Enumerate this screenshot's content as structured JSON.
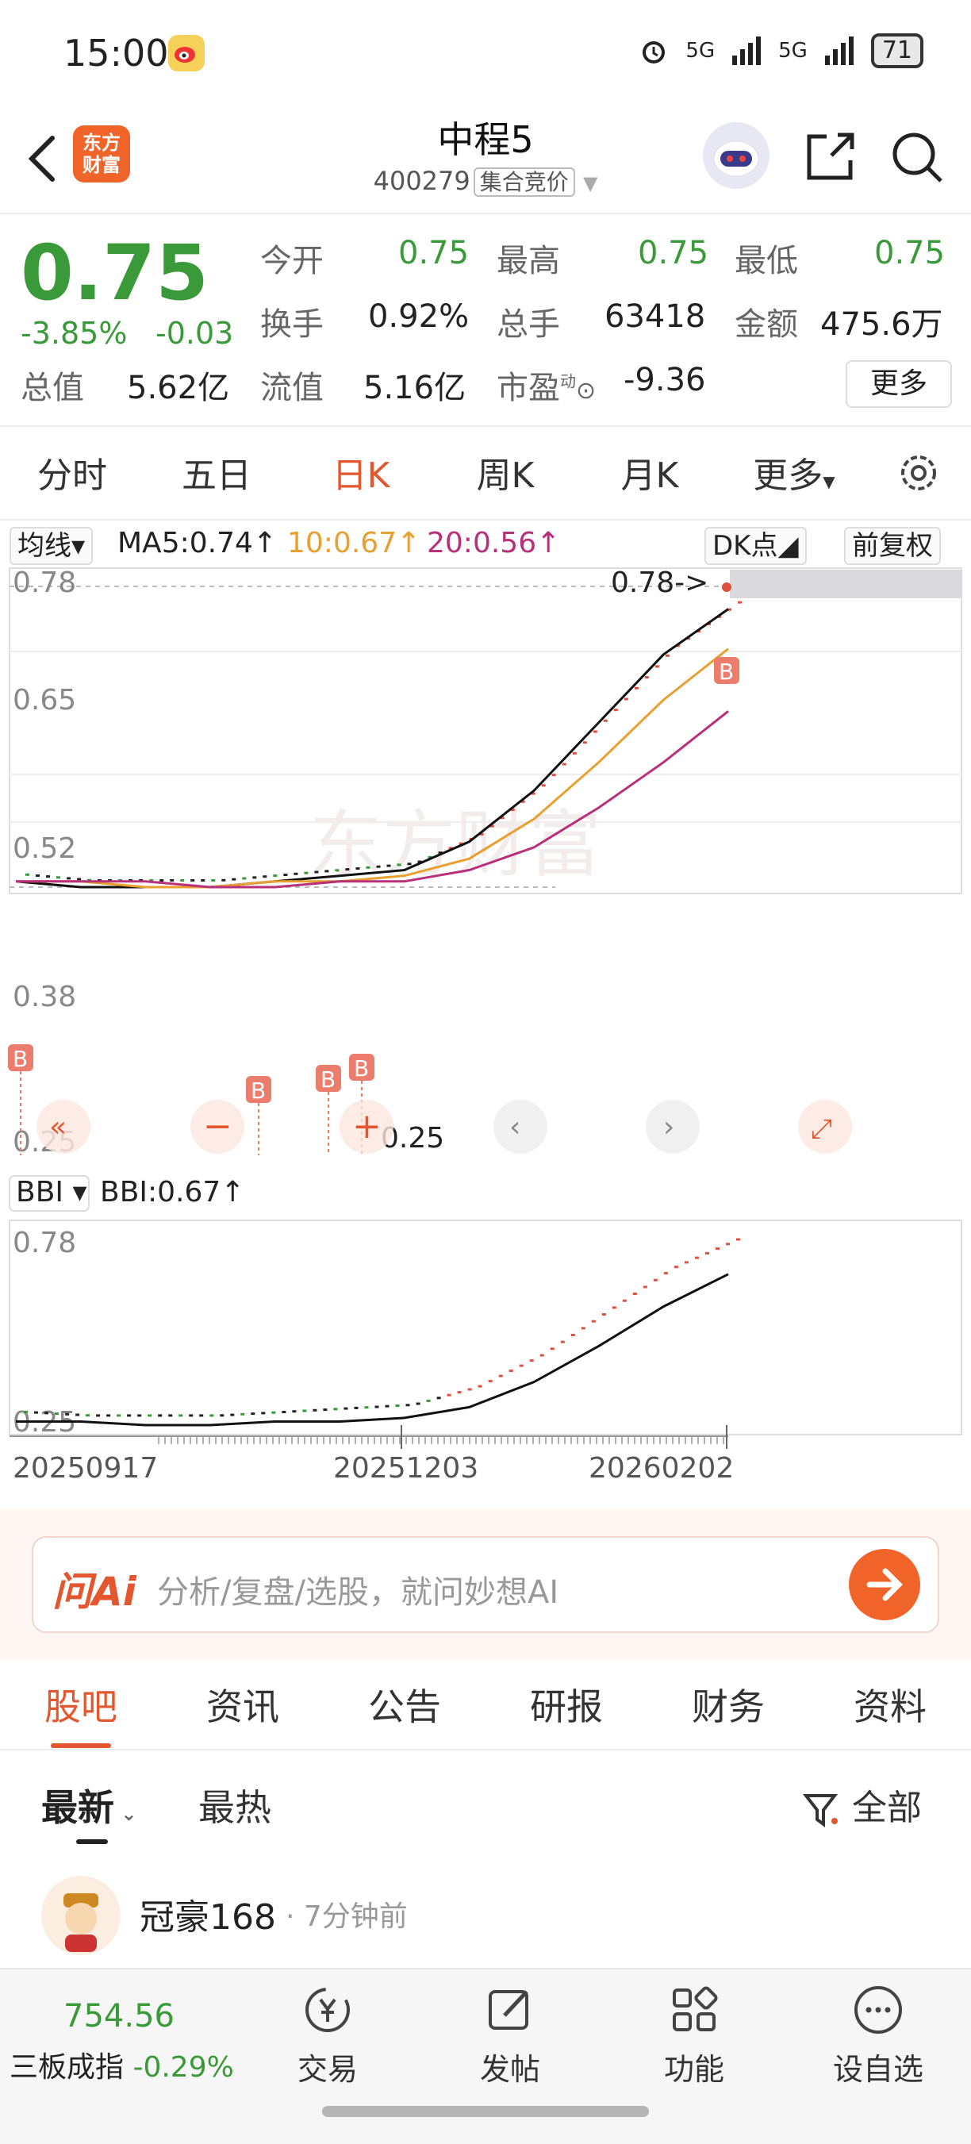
{
  "status": {
    "time": "15:00",
    "net1": "5G",
    "net2": "5G",
    "battery": "71"
  },
  "header": {
    "logo_line1": "东方",
    "logo_line2": "财富",
    "title": "中程5",
    "code": "400279",
    "tag": "集合竞价"
  },
  "quote": {
    "price": "0.75",
    "change_pct": "-3.85%",
    "change_abs": "-0.03",
    "open_label": "今开",
    "open_value": "0.75",
    "high_label": "最高",
    "high_value": "0.75",
    "low_label": "最低",
    "low_value": "0.75",
    "turnover_label": "换手",
    "turnover_value": "0.92%",
    "volume_label": "总手",
    "volume_value": "63418",
    "amount_label": "金额",
    "amount_value": "475.6万",
    "mktcap_label": "总值",
    "mktcap_value": "5.62亿",
    "float_label": "流值",
    "float_value": "5.16亿",
    "pe_label": "市盈",
    "pe_sup": "动",
    "pe_value": "-9.36",
    "more_label": "更多"
  },
  "ktabs": [
    "分时",
    "五日",
    "日K",
    "周K",
    "月K",
    "更多"
  ],
  "ktab_active": 2,
  "chart": {
    "ma_selector": "均线",
    "ma5": "MA5:0.74↑",
    "ma10": "10:0.67↑",
    "ma20": "20:0.56↑",
    "dk_label": "DK点",
    "adjust_label": "前复权",
    "price_ticks": [
      "0.78",
      "0.65",
      "0.52",
      "0.38",
      "0.25"
    ],
    "high_marker": "0.78->",
    "low_marker": "0.25",
    "watermark": "东方财富",
    "buy_marker": "B",
    "bbi_selector": "BBI",
    "bbi_value": "BBI:0.67↑",
    "bbi_ticks": [
      "0.78",
      "0.25"
    ],
    "dates": [
      "20250917",
      "20251203",
      "20260202"
    ],
    "colors": {
      "ma5": "#111111",
      "ma10": "#e8a030",
      "ma20": "#b8307a",
      "up": "#e05040",
      "down": "#3a9a3a"
    }
  },
  "chart_data": {
    "type": "line",
    "x": [
      "20250917",
      "20251203",
      "20260202"
    ],
    "series": [
      {
        "name": "MA5",
        "values": [
          0.26,
          0.25,
          0.25,
          0.25,
          0.26,
          0.27,
          0.28,
          0.33,
          0.42,
          0.54,
          0.66,
          0.74
        ]
      },
      {
        "name": "10",
        "values": [
          0.26,
          0.26,
          0.25,
          0.25,
          0.26,
          0.26,
          0.27,
          0.3,
          0.37,
          0.47,
          0.58,
          0.67
        ]
      },
      {
        "name": "20",
        "values": [
          0.26,
          0.26,
          0.26,
          0.25,
          0.25,
          0.26,
          0.26,
          0.28,
          0.32,
          0.39,
          0.47,
          0.56
        ]
      }
    ],
    "ylim": [
      0.25,
      0.78
    ]
  },
  "ai": {
    "brand": "问Ai",
    "placeholder": "分析/复盘/选股，就问妙想AI"
  },
  "subtabs": [
    "股吧",
    "资讯",
    "公告",
    "研报",
    "财务",
    "资料"
  ],
  "sort": {
    "latest": "最新",
    "hottest": "最热",
    "filter": "全部"
  },
  "feed": [
    {
      "user": "冠豪168",
      "time": "7分钟前"
    }
  ],
  "bottom": {
    "index_value": "754.56",
    "index_name": "三板成指",
    "index_change": "-0.29%",
    "trade": "交易",
    "post": "发帖",
    "functions": "功能",
    "watchlist": "设自选"
  }
}
